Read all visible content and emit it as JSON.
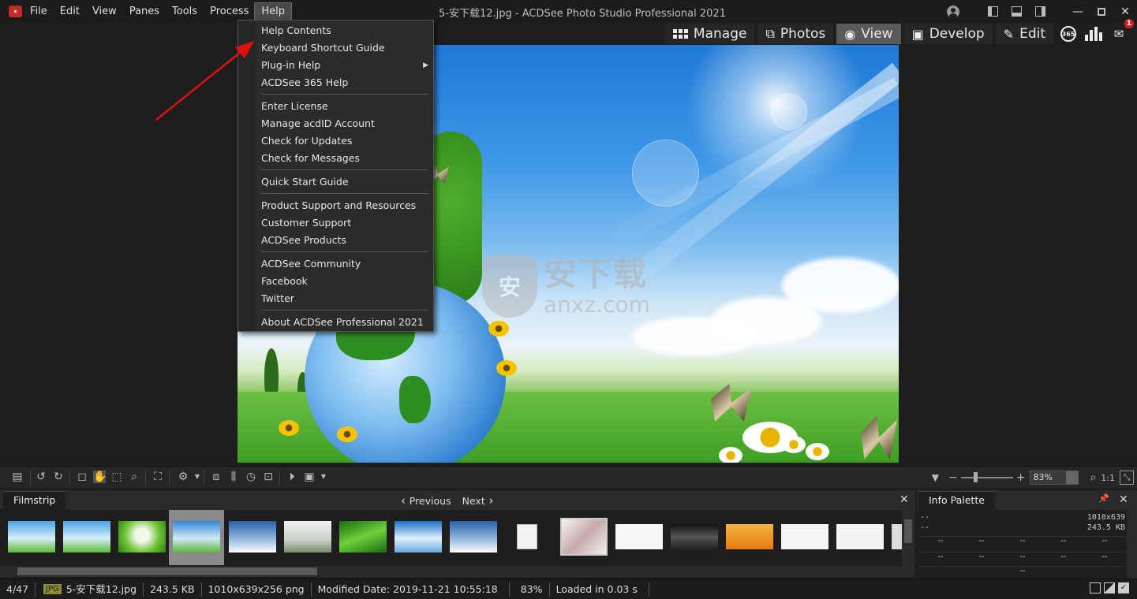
{
  "window": {
    "title": "5-安下载12.jpg - ACDSee Photo Studio Professional 2021"
  },
  "menubar": {
    "items": [
      "File",
      "Edit",
      "View",
      "Panes",
      "Tools",
      "Process",
      "Help"
    ]
  },
  "modes": {
    "manage": "Manage",
    "photos": "Photos",
    "view": "View",
    "develop": "Develop",
    "edit": "Edit",
    "badge_365": "365",
    "notification_count": "1"
  },
  "help_menu": {
    "groups": [
      [
        "Help Contents",
        "Keyboard Shortcut Guide",
        "Plug-in Help",
        "ACDSee 365 Help"
      ],
      [
        "Enter License",
        "Manage acdID Account",
        "Check for Updates",
        "Check for Messages"
      ],
      [
        "Quick Start Guide"
      ],
      [
        "Product Support and Resources",
        "Customer Support",
        "ACDSee Products"
      ],
      [
        "ACDSee Community",
        "Facebook",
        "Twitter"
      ],
      [
        "About ACDSee Professional 2021"
      ]
    ]
  },
  "watermark": {
    "badge": "安",
    "chinese": "安下载",
    "domain": "anxz.com"
  },
  "toolbar": {
    "zoom_value": "83%",
    "ratio_label": "1:1"
  },
  "filmstrip": {
    "tab": "Filmstrip",
    "previous": "Previous",
    "next": "Next"
  },
  "info_palette": {
    "tab": "Info Palette",
    "dash": "--",
    "dimensions": "1010x639",
    "size": "243.5 KB"
  },
  "statusbar": {
    "position": "4/47",
    "type_badge": "JPG",
    "filename": "5-安下载12.jpg",
    "filesize": "243.5 KB",
    "image_info": "1010x639x256 png",
    "modified": "Modified Date: 2019-11-21 10:55:18",
    "zoom": "83%",
    "loaded": "Loaded in 0.03 s"
  }
}
